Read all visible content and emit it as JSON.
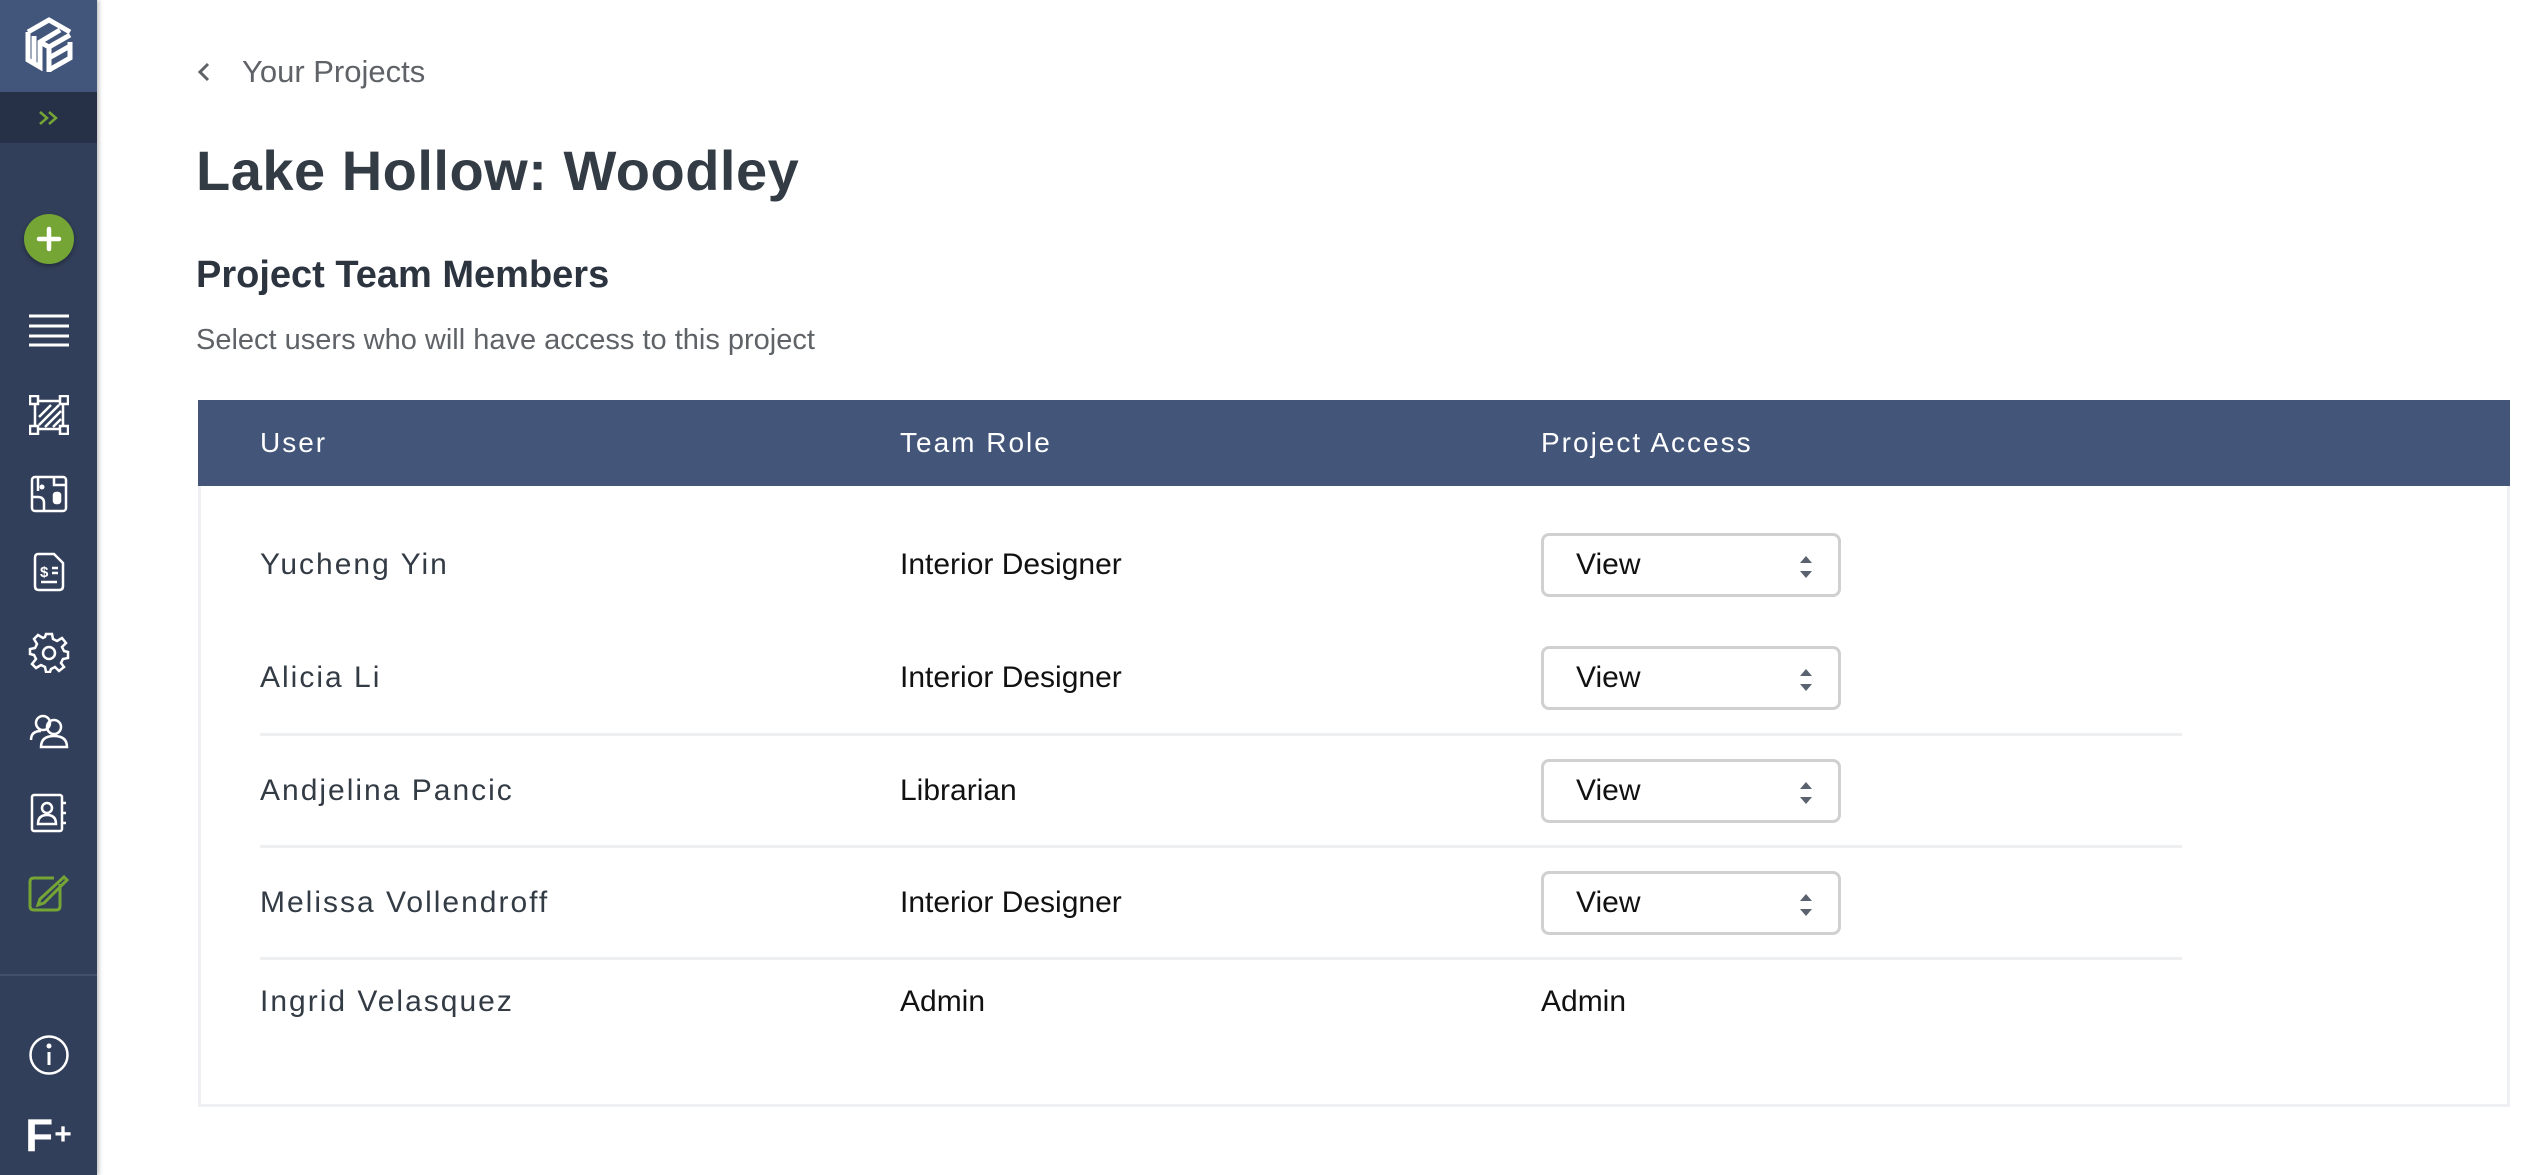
{
  "sidebar": {
    "logo": "cube-logo",
    "expand_icon": "double-chevron-right-icon",
    "add_button": "plus-icon",
    "items": [
      {
        "name": "list-icon",
        "active": false
      },
      {
        "name": "shape-icon",
        "active": false
      },
      {
        "name": "floorplan-icon",
        "active": false
      },
      {
        "name": "invoice-icon",
        "active": false
      },
      {
        "name": "gear-icon",
        "active": false
      },
      {
        "name": "users-icon",
        "active": false
      },
      {
        "name": "contacts-icon",
        "active": false
      },
      {
        "name": "edit-icon",
        "active": true
      }
    ],
    "bottom": [
      {
        "name": "info-icon"
      },
      {
        "name": "f-plus-icon",
        "label": "F",
        "sub": "+"
      }
    ],
    "accent_color": "#74a535"
  },
  "header": {
    "back_label": "Your Projects",
    "title": "Lake Hollow: Woodley"
  },
  "section": {
    "title": "Project Team Members",
    "subtitle": "Select users who will have access to this project"
  },
  "table": {
    "columns": [
      "User",
      "Team Role",
      "Project Access"
    ],
    "rows": [
      {
        "user": "Yucheng Yin",
        "role": "Interior Designer",
        "access": "View",
        "editable": true
      },
      {
        "user": "Alicia Li",
        "role": "Interior Designer",
        "access": "View",
        "editable": true
      },
      {
        "user": "Andjelina Pancic",
        "role": "Librarian",
        "access": "View",
        "editable": true
      },
      {
        "user": "Melissa Vollendroff",
        "role": "Interior Designer",
        "access": "View",
        "editable": true
      },
      {
        "user": "Ingrid Velasquez",
        "role": "Admin",
        "access": "Admin",
        "editable": false
      }
    ],
    "header_color": "#43567a"
  }
}
